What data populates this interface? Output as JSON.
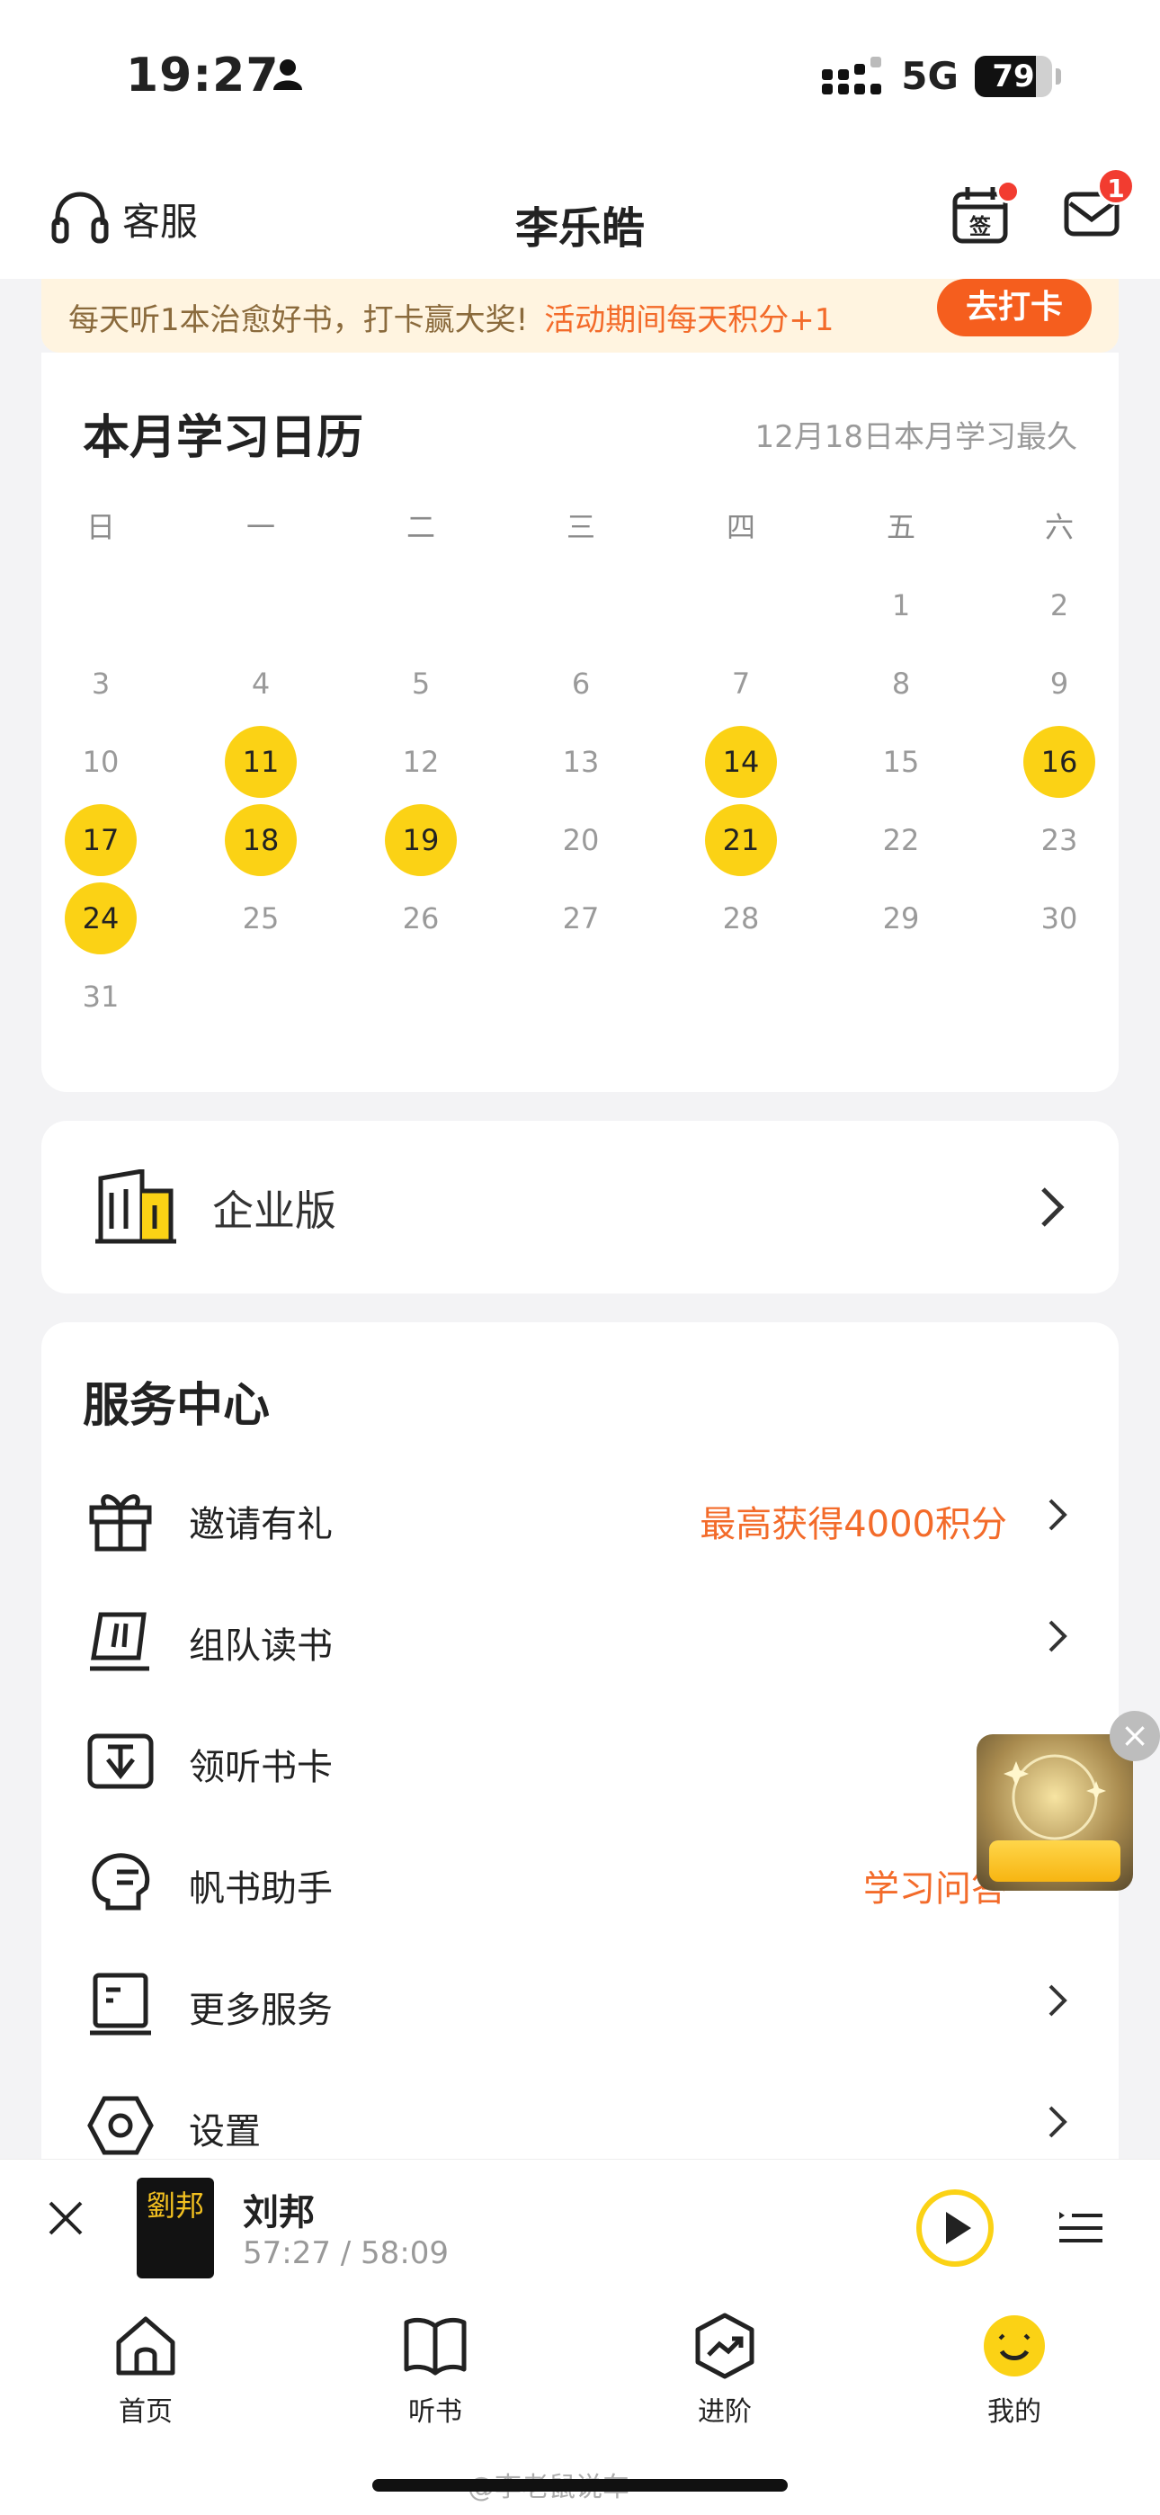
{
  "status_bar": {
    "time": "19:27",
    "network": "5G",
    "battery": "79",
    "battery_level": 0.79
  },
  "nav": {
    "service_label": "客服",
    "title": "李乐皓",
    "checkin_glyph": "签",
    "mail_badge": "1"
  },
  "banner": {
    "text": "每天听1本治愈好书，打卡赢大奖!",
    "highlight": "活动期间每天积分+1",
    "button": "去打卡"
  },
  "calendar": {
    "title": "本月学习日历",
    "note": "12月18日本月学习最久",
    "weekdays": [
      "日",
      "一",
      "二",
      "三",
      "四",
      "五",
      "六"
    ],
    "weeks": [
      [
        "",
        "",
        "",
        "",
        "",
        "1",
        "2"
      ],
      [
        "3",
        "4",
        "5",
        "6",
        "7",
        "8",
        "9"
      ],
      [
        "10",
        "11",
        "12",
        "13",
        "14",
        "15",
        "16"
      ],
      [
        "17",
        "18",
        "19",
        "20",
        "21",
        "22",
        "23"
      ],
      [
        "24",
        "25",
        "26",
        "27",
        "28",
        "29",
        "30"
      ],
      [
        "31",
        "",
        "",
        "",
        "",
        "",
        ""
      ]
    ],
    "studied_days": [
      "11",
      "14",
      "16",
      "17",
      "18",
      "19",
      "21",
      "24"
    ],
    "highlight_color": "#fbd215"
  },
  "enterprise": {
    "label": "企业版"
  },
  "services": {
    "title": "服务中心",
    "items": [
      {
        "label": "邀请有礼",
        "extra": "最高获得4000积分",
        "icon": "gift-icon"
      },
      {
        "label": "组队读书",
        "extra": "",
        "icon": "flag-icon"
      },
      {
        "label": "领听书卡",
        "extra": "",
        "icon": "card-icon"
      },
      {
        "label": "帆书助手",
        "extra": "学习问答",
        "icon": "assistant-icon"
      },
      {
        "label": "更多服务",
        "extra": "",
        "icon": "book-icon"
      },
      {
        "label": "设置",
        "extra": "",
        "icon": "settings-icon"
      }
    ],
    "accent_color": "#f36b2a"
  },
  "player": {
    "cover_text": "劉邦",
    "title": "刘邦",
    "time": "57:27 / 58:09"
  },
  "tabs": [
    {
      "label": "首页",
      "icon": "home-icon"
    },
    {
      "label": "听书",
      "icon": "book-open-icon"
    },
    {
      "label": "进阶",
      "icon": "growth-icon"
    },
    {
      "label": "我的",
      "icon": "smile-icon"
    }
  ],
  "watermark": "@李老鼠说车"
}
